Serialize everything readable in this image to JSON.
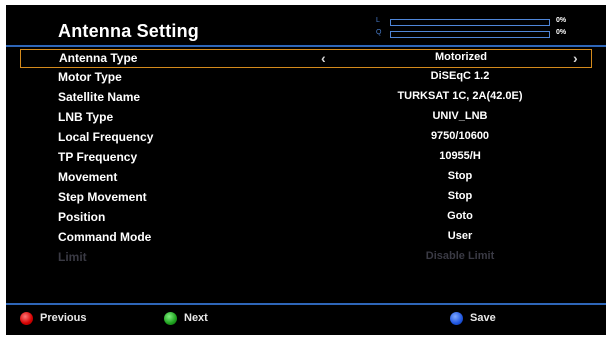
{
  "header": {
    "title": "Antenna Setting",
    "signal": {
      "level_letter": "L",
      "level_percent": "0%",
      "level_value": 0,
      "quality_letter": "Q",
      "quality_percent": "0%",
      "quality_value": 0
    }
  },
  "settings": [
    {
      "label": "Antenna Type",
      "value": "Motorized",
      "selected": true
    },
    {
      "label": "Motor Type",
      "value": "DiSEqC 1.2"
    },
    {
      "label": "Satellite Name",
      "value": "TURKSAT 1C, 2A(42.0E)"
    },
    {
      "label": "LNB Type",
      "value": "UNIV_LNB"
    },
    {
      "label": "Local Frequency",
      "value": "9750/10600"
    },
    {
      "label": "TP Frequency",
      "value": "10955/H"
    },
    {
      "label": "Movement",
      "value": "Stop"
    },
    {
      "label": "Step Movement",
      "value": "Stop"
    },
    {
      "label": "Position",
      "value": "Goto"
    },
    {
      "label": "Command Mode",
      "value": "User"
    },
    {
      "label": "Limit",
      "value": "Disable Limit",
      "disabled": true
    }
  ],
  "selector_arrows": {
    "left": "‹",
    "right": "›"
  },
  "footer": {
    "previous_label": "Previous",
    "next_label": "Next",
    "save_label": "Save"
  },
  "colors": {
    "background": "#000000",
    "accent_blue": "#2e66b8",
    "selection_border": "#d48a1c",
    "disabled_text": "#3a3a44"
  },
  "icons": {
    "previous": "red-button-icon",
    "next": "green-button-icon",
    "save": "blue-button-icon"
  }
}
